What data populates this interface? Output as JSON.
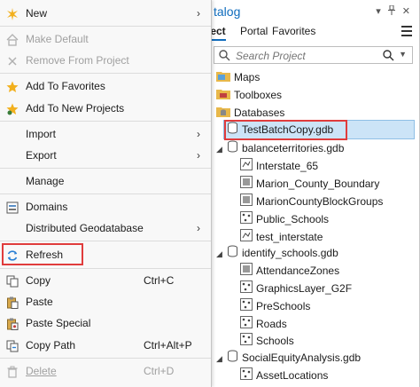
{
  "catalog": {
    "title": "talog",
    "tabs": [
      {
        "label": "ject"
      },
      {
        "label": "Portal"
      },
      {
        "label": "Favorites"
      }
    ],
    "search": {
      "placeholder": "Search Project"
    },
    "tree": {
      "maps": "Maps",
      "toolboxes": "Toolboxes",
      "databases": "Databases",
      "selected": "TestBatchCopy.gdb",
      "gdb1": "balanceterritories.gdb",
      "gdb1_items": [
        "Interstate_65",
        "Marion_County_Boundary",
        "MarionCountyBlockGroups",
        "Public_Schools",
        "test_interstate"
      ],
      "gdb2": "identify_schools.gdb",
      "gdb2_items": [
        "AttendanceZones",
        "GraphicsLayer_G2F",
        "PreSchools",
        "Roads",
        "Schools"
      ],
      "gdb3": "SocialEquityAnalysis.gdb",
      "gdb3_items": [
        "AssetLocations"
      ]
    }
  },
  "menu": {
    "new": "New",
    "make_default": "Make Default",
    "remove_from_project": "Remove From Project",
    "add_to_favorites": "Add To Favorites",
    "add_to_new_projects": "Add To New Projects",
    "import": "Import",
    "export": "Export",
    "manage": "Manage",
    "domains": "Domains",
    "distributed_geodatabase": "Distributed Geodatabase",
    "refresh": "Refresh",
    "copy": "Copy",
    "copy_shortcut": "Ctrl+C",
    "paste": "Paste",
    "paste_special": "Paste Special",
    "copy_path": "Copy Path",
    "copy_path_shortcut": "Ctrl+Alt+P",
    "delete": "Delete",
    "delete_shortcut": "Ctrl+D"
  },
  "colors": {
    "accent": "#0f6cbd",
    "highlight_box": "#e03c3c",
    "selection": "#cce4f7",
    "star": "#f2b01e",
    "folder": "#e8b84a"
  }
}
